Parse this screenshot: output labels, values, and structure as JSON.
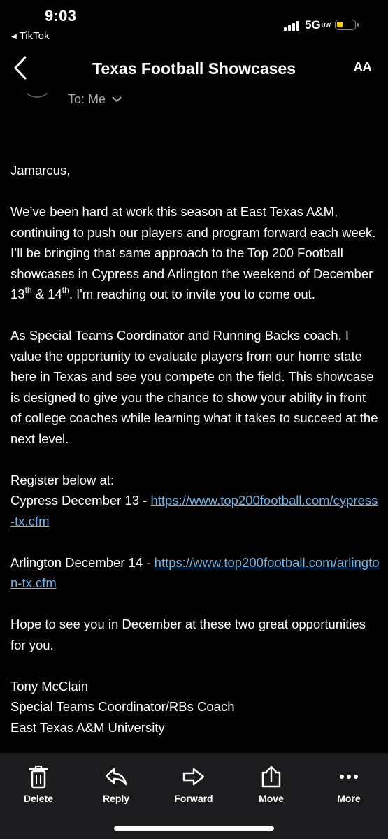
{
  "status": {
    "time": "9:03",
    "back_app": "TikTok",
    "network": "5G",
    "network_sub": "UW",
    "battery_color": "#f5d000"
  },
  "header": {
    "title": "Texas Football Showcases",
    "text_size_button": "AA"
  },
  "recipient": {
    "to": "To: Me"
  },
  "email": {
    "greeting": "Jamarcus,",
    "p1_before_sup1": "We’ve been hard at work this season at East Texas A&M, continuing to push our players and program forward each week. I’ll be bringing that same approach to the Top 200 Football showcases in Cypress and Arlington the weekend of December 13",
    "sup": "th",
    "p1_between": " & 14",
    "p1_after": ". I'm reaching out to invite you to come out.",
    "p2": "As Special Teams Coordinator and Running Backs coach, I value the opportunity to evaluate players from our home state here in Texas and see you compete on the field. This showcase is designed to give you the chance to show your ability in front of college coaches while learning what it takes to succeed at the next level.",
    "register_intro": "Register below at:",
    "cypress_label": "Cypress December 13 - ",
    "cypress_link": "https://www.top200football.com/cypress-tx.cfm",
    "arlington_label": "Arlington December 14 - ",
    "arlington_link": "https://www.top200football.com/arlington-tx.cfm",
    "closing": "Hope to see you in December at these two great opportunities for you.",
    "sig_name": "Tony McClain",
    "sig_title": "Special Teams Coordinator/RBs Coach",
    "sig_org": "East Texas A&M University"
  },
  "toolbar": {
    "delete": "Delete",
    "reply": "Reply",
    "forward": "Forward",
    "move": "Move",
    "more": "More"
  },
  "colors": {
    "background": "#000000",
    "link": "#6db5e9",
    "toolbar": "#1c1c1e"
  }
}
